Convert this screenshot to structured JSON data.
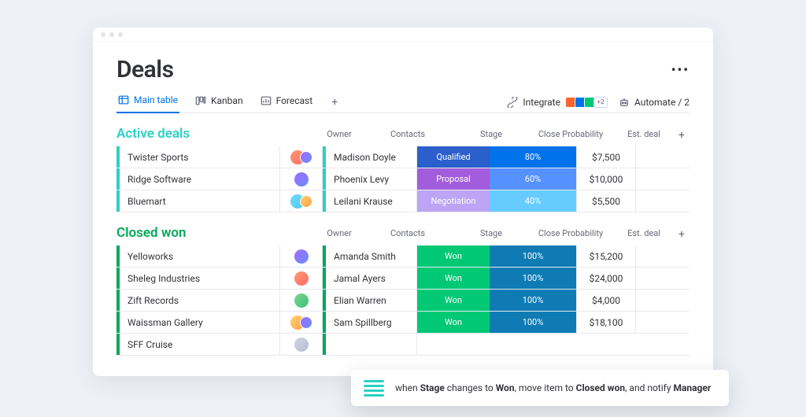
{
  "header": {
    "title": "Deals"
  },
  "tabs": [
    {
      "label": "Main table",
      "icon": "table-icon",
      "active": true
    },
    {
      "label": "Kanban",
      "icon": "kanban-icon",
      "active": false
    },
    {
      "label": "Forecast",
      "icon": "chart-icon",
      "active": false
    }
  ],
  "toolbar": {
    "integrate_label": "Integrate",
    "integrate_extra_count": "+2",
    "automate_label": "Automate / 2"
  },
  "columns": {
    "owner": "Owner",
    "contacts": "Contacts",
    "stage": "Stage",
    "prob": "Close Probability",
    "est": "Est. deal"
  },
  "groups": [
    {
      "key": "active",
      "title": "Active deals",
      "color": "#2bd1c4",
      "rows": [
        {
          "name": "Twister Sports",
          "owner_avatars": [
            "av-a",
            "av-b"
          ],
          "contact": "Madison Doyle",
          "stage": "Qualified",
          "stage_class": "stage-qualified",
          "prob": "80%",
          "prob_class": "prob-80",
          "est": "$7,500"
        },
        {
          "name": "Ridge Software",
          "owner_avatars": [
            "av-b"
          ],
          "contact": "Phoenix Levy",
          "stage": "Proposal",
          "stage_class": "stage-proposal",
          "prob": "60%",
          "prob_class": "prob-60",
          "est": "$10,000"
        },
        {
          "name": "Bluemart",
          "owner_avatars": [
            "av-c",
            "av-d"
          ],
          "contact": "Leilani Krause",
          "stage": "Negotiation",
          "stage_class": "stage-negotiation",
          "prob": "40%",
          "prob_class": "prob-40",
          "est": "$5,500"
        }
      ]
    },
    {
      "key": "closed",
      "title": "Closed won",
      "color": "#00a859",
      "rows": [
        {
          "name": "Yelloworks",
          "owner_avatars": [
            "av-b"
          ],
          "contact": "Amanda Smith",
          "stage": "Won",
          "stage_class": "stage-won",
          "prob": "100%",
          "prob_class": "prob-100",
          "est": "$15,200"
        },
        {
          "name": "Sheleg Industries",
          "owner_avatars": [
            "av-a"
          ],
          "contact": "Jamal Ayers",
          "stage": "Won",
          "stage_class": "stage-won",
          "prob": "100%",
          "prob_class": "prob-100",
          "est": "$24,000"
        },
        {
          "name": "Zift Records",
          "owner_avatars": [
            "av-e"
          ],
          "contact": "Elian Warren",
          "stage": "Won",
          "stage_class": "stage-won",
          "prob": "100%",
          "prob_class": "prob-100",
          "est": "$4,000"
        },
        {
          "name": "Waissman Gallery",
          "owner_avatars": [
            "av-d",
            "av-b"
          ],
          "contact": "Sam Spillberg",
          "stage": "Won",
          "stage_class": "stage-won",
          "prob": "100%",
          "prob_class": "prob-100",
          "est": "$18,100"
        },
        {
          "name": "SFF Cruise",
          "owner_avatars": [
            "av-f"
          ],
          "contact": "",
          "stage": "",
          "stage_class": "",
          "prob": "",
          "prob_class": "",
          "est": "",
          "cut": true
        }
      ]
    }
  ],
  "recipe": {
    "prefix": "when ",
    "b1": "Stage",
    "mid1": " changes to ",
    "b2": "Won",
    "mid2": ", move item to ",
    "b3": "Closed won",
    "mid3": ", and notify ",
    "b4": "Manager"
  }
}
